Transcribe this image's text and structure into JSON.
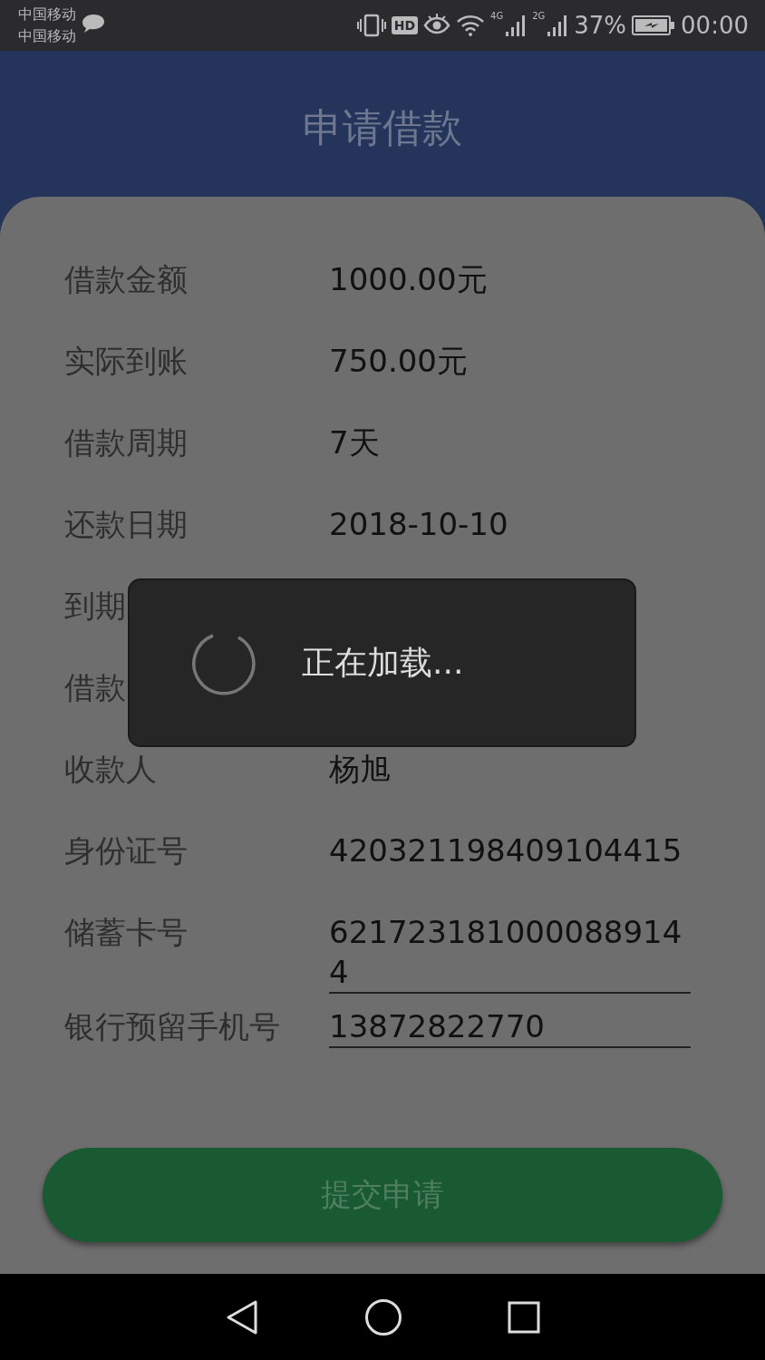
{
  "status_bar": {
    "carriers": [
      "中国移动",
      "中国移动"
    ],
    "hd": "HD",
    "networks": [
      "4G",
      "2G"
    ],
    "battery": "37%",
    "time": "00:00"
  },
  "header": {
    "title": "申请借款"
  },
  "rows": [
    {
      "kind": "plain",
      "label": "借款金额",
      "value": "1000.00元"
    },
    {
      "kind": "plain",
      "label": "实际到账",
      "value": "750.00元"
    },
    {
      "kind": "plain",
      "label": "借款周期",
      "value": "7天"
    },
    {
      "kind": "plain",
      "label": "还款日期",
      "value": "2018-10-10"
    },
    {
      "kind": "plain",
      "label": "到期"
    },
    {
      "kind": "plain",
      "label": "借款"
    },
    {
      "kind": "plain",
      "label": "收款人",
      "value": "杨旭"
    },
    {
      "kind": "plain",
      "label": "身份证号",
      "value": "420321198409104415"
    },
    {
      "kind": "field",
      "label": "储蓄卡号",
      "value": "6217231810000889144"
    },
    {
      "kind": "field",
      "label": "银行预留手机号",
      "value": "13872822770"
    }
  ],
  "submit_button": "提交申请",
  "loading_dialog": {
    "message": "正在加载..."
  }
}
